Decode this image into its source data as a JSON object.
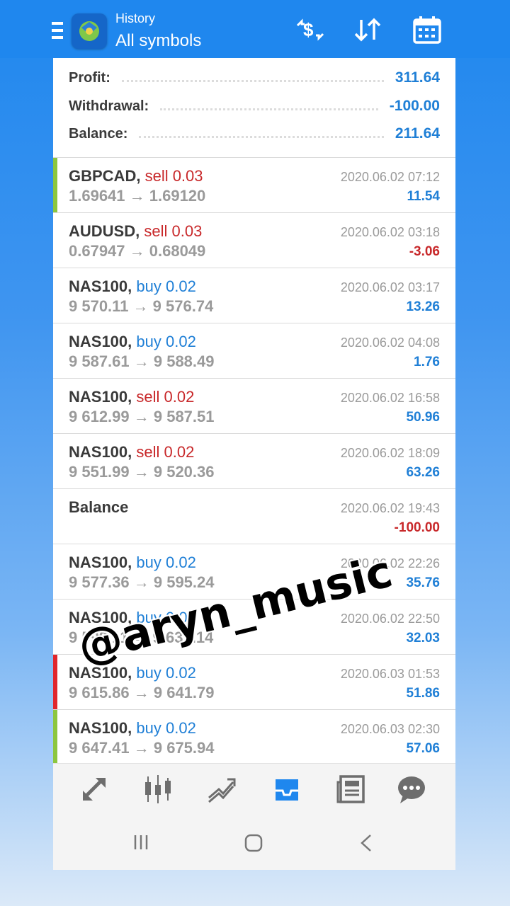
{
  "header": {
    "title_small": "History",
    "title_large": "All symbols",
    "icons": [
      "menu-icon",
      "app-logo",
      "deposit-filter-icon",
      "sort-icon",
      "calendar-icon"
    ]
  },
  "summary": {
    "profit_label": "Profit:",
    "profit_value": "311.64",
    "withdrawal_label": "Withdrawal:",
    "withdrawal_value": "-100.00",
    "balance_label": "Balance:",
    "balance_value": "211.64"
  },
  "trades": [
    {
      "symbol": "GBPCAD,",
      "side": "sell 0.03",
      "prices": "1.69641 → 1.69120",
      "date": "2020.06.02 07:12",
      "profit": "11.54"
    },
    {
      "symbol": "AUDUSD,",
      "side": "sell 0.03",
      "prices": "0.67947 → 0.68049",
      "date": "2020.06.02 03:18",
      "profit": "-3.06"
    },
    {
      "symbol": "NAS100,",
      "side": "buy 0.02",
      "prices": "9 570.11 → 9 576.74",
      "date": "2020.06.02 03:17",
      "profit": "13.26"
    },
    {
      "symbol": "NAS100,",
      "side": "buy 0.02",
      "prices": "9 587.61 → 9 588.49",
      "date": "2020.06.02 04:08",
      "profit": "1.76"
    },
    {
      "symbol": "NAS100,",
      "side": "sell 0.02",
      "prices": "9 612.99 → 9 587.51",
      "date": "2020.06.02 16:58",
      "profit": "50.96"
    },
    {
      "symbol": "NAS100,",
      "side": "sell 0.02",
      "prices": "9 551.99 → 9 520.36",
      "date": "2020.06.02 18:09",
      "profit": "63.26"
    },
    {
      "symbol": "Balance",
      "side": "",
      "prices": "",
      "date": "2020.06.02 19:43",
      "profit": "-100.00"
    },
    {
      "symbol": "NAS100,",
      "side": "buy 0.02",
      "prices": "9 577.36 → 9 595.24",
      "date": "2020.06.02 22:26",
      "profit": "35.76"
    },
    {
      "symbol": "NAS100,",
      "side": "buy 0.01",
      "prices": "9 599.11 → 9 631.14",
      "date": "2020.06.02 22:50",
      "profit": "32.03"
    },
    {
      "symbol": "NAS100,",
      "side": "buy 0.02",
      "prices": "9 615.86 → 9 641.79",
      "date": "2020.06.03 01:53",
      "profit": "51.86"
    },
    {
      "symbol": "NAS100,",
      "side": "buy 0.02",
      "prices": "9 647.41 → 9 675.94",
      "date": "2020.06.03 02:30",
      "profit": "57.06"
    }
  ],
  "colors": {
    "header_blue": "#1f87ee",
    "profit_blue": "#1f7fd6",
    "loss_red": "#c8282a",
    "edge_green": "#8cc63f",
    "edge_red": "#e0262d",
    "active_tab": "#1f87ee"
  },
  "bottom_nav": [
    "quotes-icon",
    "chart-icon",
    "trade-icon",
    "history-icon",
    "news-icon",
    "chat-icon"
  ],
  "watermark": "@aryn_music"
}
